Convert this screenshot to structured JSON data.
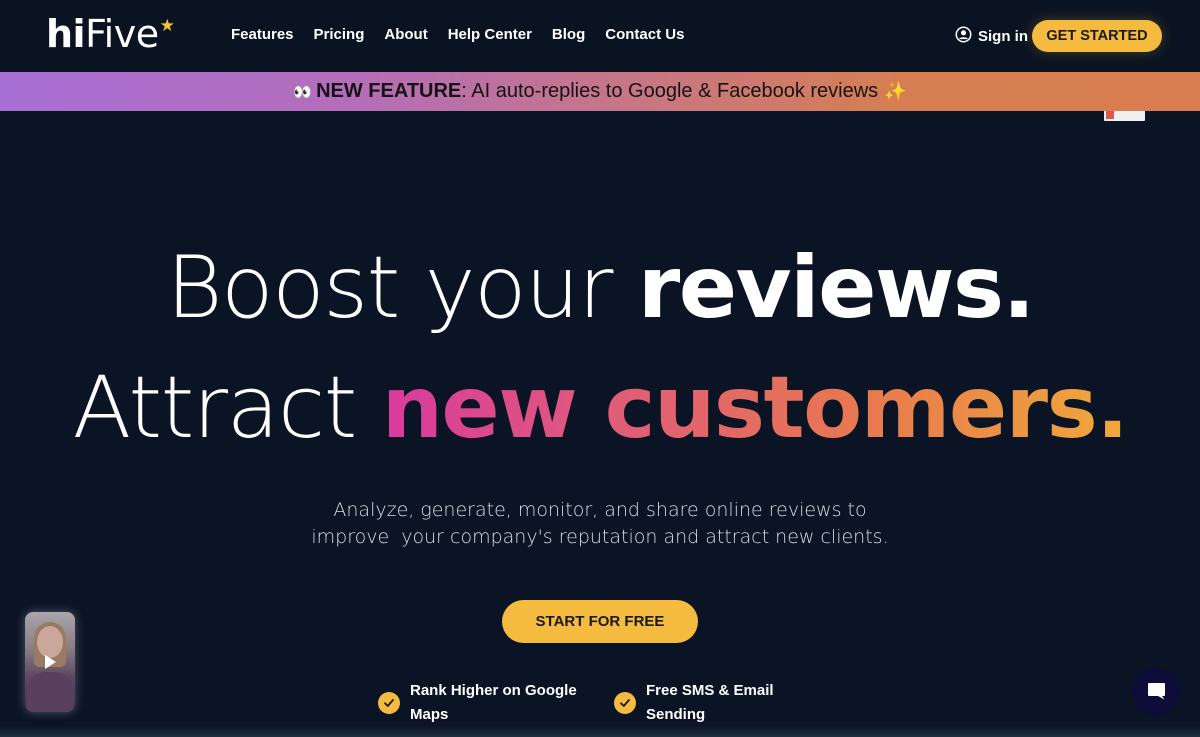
{
  "nav": {
    "logo": {
      "hi": "hi",
      "five": "Five",
      "star": "★"
    },
    "links": [
      "Features",
      "Pricing",
      "About",
      "Help Center",
      "Blog",
      "Contact Us"
    ],
    "sign_in": "Sign in",
    "get_started": "GET STARTED"
  },
  "banner": {
    "eyes": "👀",
    "label": "NEW FEATURE",
    "text": ": AI auto-replies to Google & Facebook reviews",
    "sparkle": "✨"
  },
  "hero": {
    "line1_light": "Boost your ",
    "line1_bold": "reviews.",
    "line2_light": "Attract ",
    "line2_grad": "new customers.",
    "subtitle_line1": "Analyze, generate, monitor, and share online reviews to",
    "subtitle_line2": "improve  your company's reputation and attract new clients.",
    "cta": "START FOR FREE",
    "features": [
      "Rank Higher on Google Maps",
      "Free SMS & Email Sending"
    ]
  },
  "colors": {
    "accent": "#f4bb3f",
    "background": "#0b1424",
    "chat": "#0d0c3a"
  }
}
